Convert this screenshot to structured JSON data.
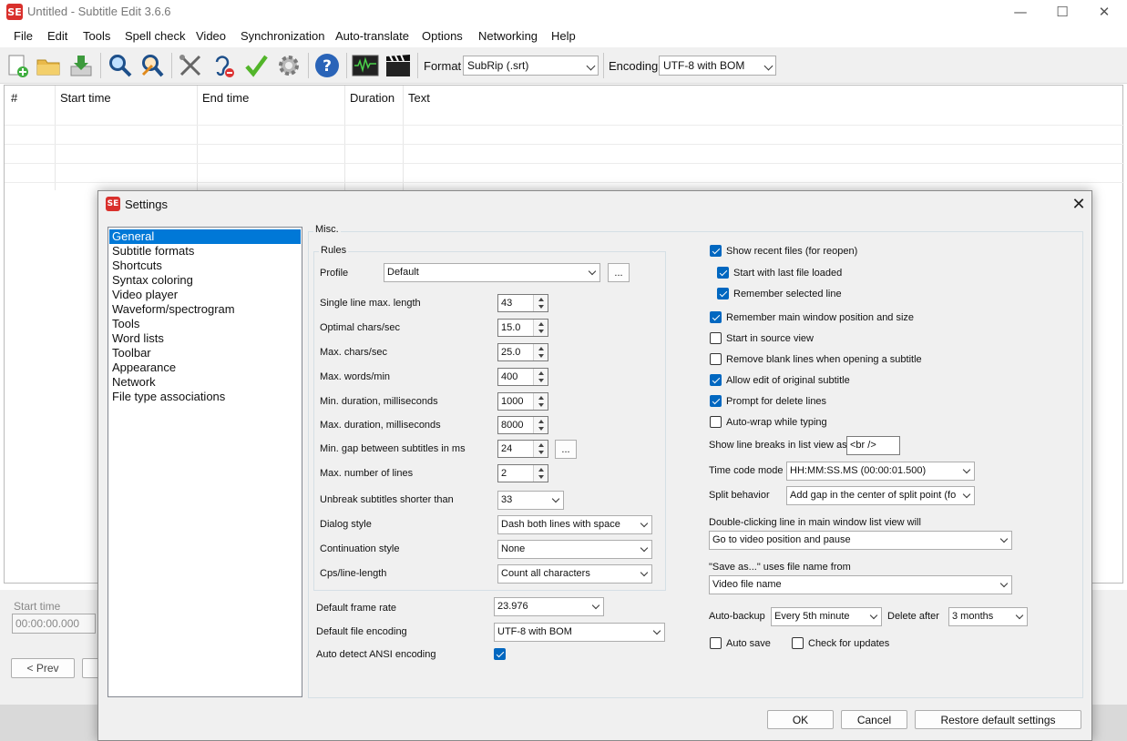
{
  "window": {
    "title": "Untitled - Subtitle Edit 3.6.6",
    "app_icon": "SE",
    "minimize": "—",
    "maximize": "☐",
    "close": "✕"
  },
  "menu": [
    "File",
    "Edit",
    "Tools",
    "Spell check",
    "Video",
    "Synchronization",
    "Auto-translate",
    "Options",
    "Networking",
    "Help"
  ],
  "toolbar": {
    "format_label": "Format",
    "format_value": "SubRip (.srt)",
    "encoding_label": "Encoding",
    "encoding_value": "UTF-8 with BOM"
  },
  "grid": {
    "columns": [
      "#",
      "Start time",
      "End time",
      "Duration",
      "Text"
    ]
  },
  "lower": {
    "start_time_label": "Start time",
    "start_time_value": "00:00:00.000",
    "prev_button": "< Prev"
  },
  "dialog": {
    "title": "Settings",
    "close": "✕",
    "nav": [
      "General",
      "Subtitle formats",
      "Shortcuts",
      "Syntax coloring",
      "Video player",
      "Waveform/spectrogram",
      "Tools",
      "Word lists",
      "Toolbar",
      "Appearance",
      "Network",
      "File type associations"
    ],
    "selected_nav": "General",
    "misc_label": "Misc.",
    "rules": {
      "label": "Rules",
      "profile_label": "Profile",
      "profile_value": "Default",
      "dots": "...",
      "single_line_max_label": "Single line max. length",
      "single_line_max_value": "43",
      "optimal_cps_label": "Optimal chars/sec",
      "optimal_cps_value": "15.0",
      "max_cps_label": "Max. chars/sec",
      "max_cps_value": "25.0",
      "max_wpm_label": "Max. words/min",
      "max_wpm_value": "400",
      "min_dur_label": "Min. duration, milliseconds",
      "min_dur_value": "1000",
      "max_dur_label": "Max. duration, milliseconds",
      "max_dur_value": "8000",
      "min_gap_label": "Min. gap between subtitles in ms",
      "min_gap_value": "24",
      "max_lines_label": "Max. number of lines",
      "max_lines_value": "2",
      "unbreak_label": "Unbreak subtitles shorter than",
      "unbreak_value": "33",
      "dialog_style_label": "Dialog style",
      "dialog_style_value": "Dash both lines with space",
      "continuation_label": "Continuation style",
      "continuation_value": "None",
      "cps_line_label": "Cps/line-length",
      "cps_line_value": "Count all characters"
    },
    "frame_rate_label": "Default frame rate",
    "frame_rate_value": "23.976",
    "file_encoding_label": "Default file encoding",
    "file_encoding_value": "UTF-8 with BOM",
    "auto_ansi_label": "Auto detect ANSI encoding",
    "auto_ansi_checked": true,
    "right": {
      "show_recent": {
        "label": "Show recent files (for reopen)",
        "checked": true
      },
      "start_last": {
        "label": "Start with last file loaded",
        "checked": true
      },
      "remember_line": {
        "label": "Remember selected line",
        "checked": true
      },
      "remember_window": {
        "label": "Remember main window position and size",
        "checked": true
      },
      "start_source": {
        "label": "Start in source view",
        "checked": false
      },
      "remove_blank": {
        "label": "Remove blank lines when opening a subtitle",
        "checked": false
      },
      "allow_edit": {
        "label": "Allow edit of original subtitle",
        "checked": true
      },
      "prompt_delete": {
        "label": "Prompt for delete lines",
        "checked": true
      },
      "auto_wrap": {
        "label": "Auto-wrap while typing",
        "checked": false
      },
      "line_breaks_label": "Show line breaks in list view as",
      "line_breaks_value": "<br />",
      "timecode_label": "Time code mode",
      "timecode_value": "HH:MM:SS.MS (00:00:01.500)",
      "split_label": "Split behavior",
      "split_value": "Add gap in the center of split point (fo",
      "dblclick_label": "Double-clicking line in main window list view will",
      "dblclick_value": "Go to video position and pause",
      "saveas_label": "\"Save as...\" uses file name from",
      "saveas_value": "Video file name",
      "autobackup_label": "Auto-backup",
      "autobackup_value": "Every 5th minute",
      "delete_after_label": "Delete after",
      "delete_after_value": "3 months",
      "auto_save": {
        "label": "Auto save",
        "checked": false
      },
      "check_updates": {
        "label": "Check for updates",
        "checked": false
      }
    },
    "buttons": {
      "ok": "OK",
      "cancel": "Cancel",
      "restore": "Restore default settings"
    }
  },
  "colors": {
    "selection": "#0078d7",
    "checkbox": "#0067c0",
    "brand": "#d9302c"
  }
}
